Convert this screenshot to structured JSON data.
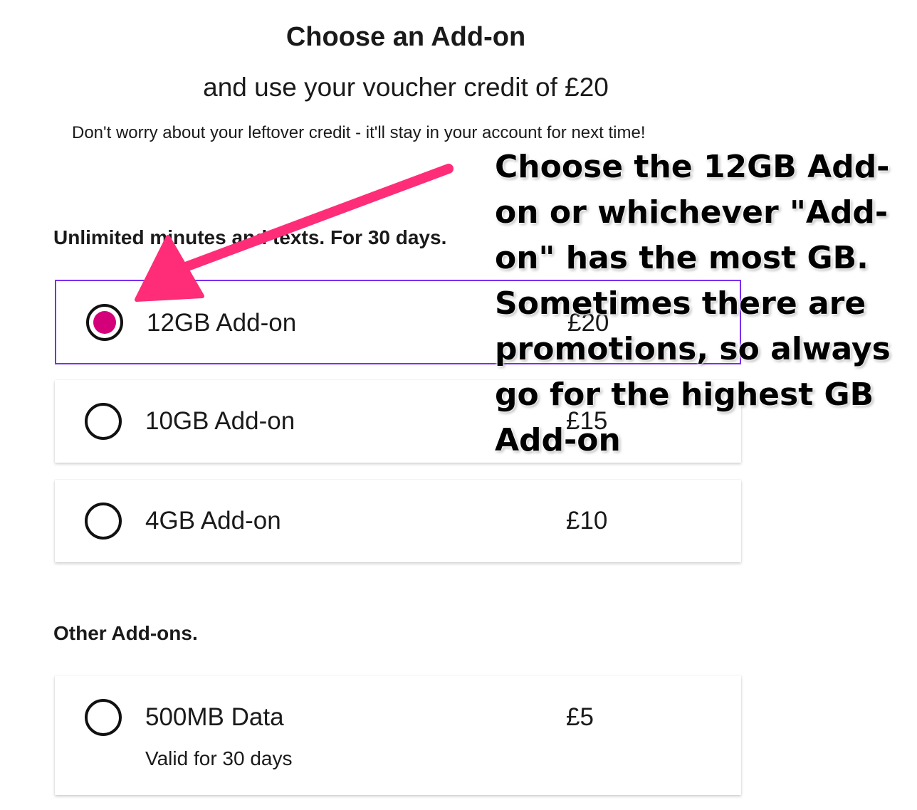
{
  "header": {
    "title": "Choose an Add-on",
    "subtitle": "and use your voucher credit of £20",
    "note": "Don't worry about your leftover credit - it'll stay in your account for next time!"
  },
  "sections": [
    {
      "heading": "Unlimited minutes and texts. For 30 days.",
      "options": [
        {
          "label": "12GB Add-on",
          "price": "£20",
          "selected": true
        },
        {
          "label": "10GB Add-on",
          "price": "£15",
          "selected": false
        },
        {
          "label": "4GB Add-on",
          "price": "£10",
          "selected": false
        }
      ]
    },
    {
      "heading": "Other Add-ons.",
      "options": [
        {
          "label": "500MB Data",
          "price": "£5",
          "sublabel": "Valid for 30 days",
          "selected": false
        }
      ]
    }
  ],
  "annotation": {
    "text": "Choose the 12GB Add-on or whichever \"Add-on\" has the most GB. Sometimes there are promotions, so always go for the highest GB Add-on",
    "arrow_color": "#ff2d78"
  },
  "colors": {
    "accent_border": "#7b2ff0",
    "radio_selected": "#d4007a"
  }
}
